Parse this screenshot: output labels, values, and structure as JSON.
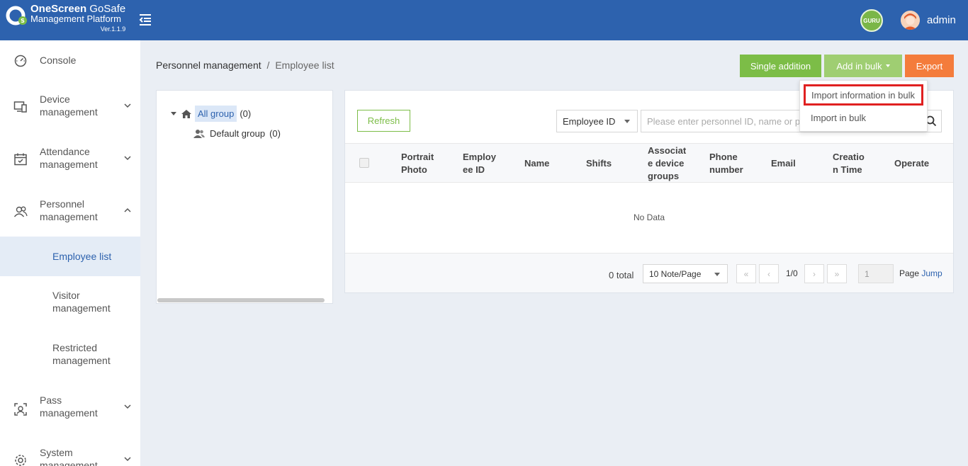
{
  "header": {
    "brand_name": "OneScreen",
    "brand_product": "GoSafe",
    "brand_sub": "Management Platform",
    "version": "Ver.1.1.9",
    "guru_badge": "GURU",
    "username": "admin",
    "colors": {
      "header_bg": "#2d62ae",
      "accent_green": "#7cbd47",
      "export_orange": "#f47c3c"
    }
  },
  "sidebar": {
    "items": [
      {
        "label": "Console",
        "icon": "dashboard-icon"
      },
      {
        "label": "Device management",
        "icon": "device-icon",
        "expanded": false
      },
      {
        "label": "Attendance management",
        "icon": "calendar-icon",
        "expanded": false
      },
      {
        "label": "Personnel management",
        "icon": "users-icon",
        "expanded": true,
        "children": [
          {
            "label": "Employee list",
            "active": true
          },
          {
            "label": "Visitor management"
          },
          {
            "label": "Restricted management"
          }
        ]
      },
      {
        "label": "Pass management",
        "icon": "face-scan-icon",
        "expanded": false
      },
      {
        "label": "System management",
        "icon": "gear-icon",
        "expanded": false
      }
    ]
  },
  "breadcrumb": {
    "parent": "Personnel management",
    "separator": "/",
    "current": "Employee list"
  },
  "toolbar": {
    "single_label": "Single addition",
    "bulk_label": "Add in bulk",
    "export_label": "Export"
  },
  "bulk_menu": {
    "items": [
      {
        "label": "Import information in bulk",
        "highlighted": true
      },
      {
        "label": "Import in bulk"
      }
    ]
  },
  "tree": {
    "root": {
      "label": "All group",
      "count": "(0)"
    },
    "children": [
      {
        "label": "Default group",
        "count": "(0)"
      }
    ]
  },
  "table": {
    "refresh_label": "Refresh",
    "search_field": "Employee ID",
    "search_placeholder": "Please enter personnel ID, name or phone",
    "columns": [
      "Portrait Photo",
      "Employee ID",
      "Name",
      "Shifts",
      "Associate device groups",
      "Phone number",
      "Email",
      "Creation Time",
      "Operate"
    ],
    "columns_display": [
      [
        "Portrait",
        "Photo"
      ],
      [
        "Employ",
        "ee ID"
      ],
      [
        "Name"
      ],
      [
        "Shifts"
      ],
      [
        "Associat",
        "e device",
        "groups"
      ],
      [
        "Phone",
        "number"
      ],
      [
        "Email"
      ],
      [
        "Creatio",
        "n Time"
      ],
      [
        "Operate"
      ]
    ],
    "empty_text": "No Data"
  },
  "pagination": {
    "total": "0 total",
    "page_size": "10 Note/Page",
    "first": "«",
    "prev": "‹",
    "info": "1/0",
    "next": "›",
    "last": "»",
    "jump_value": "1",
    "page_label": "Page",
    "jump_label": "Jump"
  }
}
